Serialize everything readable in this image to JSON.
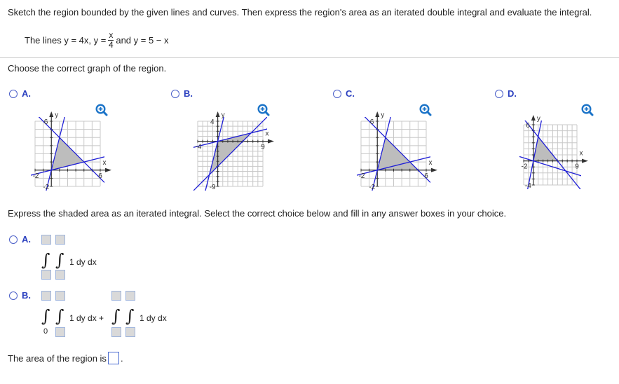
{
  "instructions": "Sketch the region bounded by the given lines and curves. Then express the region's area as an iterated double integral and evaluate the integral.",
  "problem": {
    "prefix": "The lines y = 4x, y =",
    "frac_num": "x",
    "frac_den": "4",
    "suffix": "and y = 5 − x"
  },
  "graph_question": "Choose the correct graph of the region.",
  "graph_options": [
    {
      "label": "A.",
      "zoom_icon": "magnify-plus-icon",
      "xmin": -2,
      "xmax": 6,
      "ymin": -2,
      "ymax": 6,
      "tick_labels": {
        "xmin": "-2",
        "xmax": "6",
        "ymin": "-2",
        "ymax": "6"
      },
      "lines": [
        "y = 4x",
        "y = x/4",
        "y = 5 - x"
      ],
      "shaded_vertices": [
        [
          0,
          0
        ],
        [
          1,
          4
        ],
        [
          4,
          1
        ]
      ]
    },
    {
      "label": "B.",
      "zoom_icon": "magnify-plus-icon",
      "xmin": -4,
      "xmax": 9,
      "ymin": -9,
      "ymax": 4,
      "tick_labels": {
        "xmin": "-4",
        "xmax": "9",
        "ymin": "-9",
        "ymax": "4"
      },
      "lines": [
        "y = 4x",
        "y = x/4",
        "y = x - 5"
      ],
      "shaded_vertices": [
        [
          0,
          0
        ],
        [
          6.67,
          1.67
        ],
        [
          -1.67,
          -6.67
        ]
      ]
    },
    {
      "label": "C.",
      "zoom_icon": "magnify-plus-icon",
      "xmin": -2,
      "xmax": 6,
      "ymin": -2,
      "ymax": 6,
      "tick_labels": {
        "xmin": "-2",
        "xmax": "6",
        "ymin": "-2",
        "ymax": "6"
      },
      "lines": [
        "y = 4x",
        "y = x/4",
        "y = 5 - x"
      ],
      "shaded_vertices": [
        [
          0,
          0
        ],
        [
          1,
          4
        ],
        [
          4,
          1
        ],
        [
          5,
          0
        ]
      ]
    },
    {
      "label": "D.",
      "zoom_icon": "magnify-plus-icon",
      "xmin": -2,
      "xmax": 9,
      "ymin": -4,
      "ymax": 6,
      "tick_labels": {
        "xmin": "-2",
        "xmax": "9",
        "ymin": "-4",
        "ymax": "6"
      },
      "lines": [
        "y = 4x",
        "y = -x/4",
        "y = 5 - x"
      ],
      "shaded_vertices": [
        [
          0,
          0
        ],
        [
          1,
          4
        ],
        [
          5,
          0
        ]
      ]
    }
  ],
  "integral_question": "Express the shaded area as an iterated integral. Select the correct choice below and fill in any answer boxes in your choice.",
  "integral_options": [
    {
      "label": "A.",
      "integrand": "1 dy dx"
    },
    {
      "label": "B.",
      "integrand_1": "1 dy dx +",
      "integrand_2": "1 dy dx",
      "lower_limit_fixed": "0"
    }
  ],
  "area_prompt": "The area of the region is",
  "area_suffix": ".",
  "axis_labels": {
    "x": "x",
    "y": "y"
  },
  "colors": {
    "line": "#1f1fd6",
    "shade": "#bdbdbd",
    "grid": "#c8c8c8",
    "label_blue": "#2a3fbf",
    "zoom_icon": "#1a73c8"
  }
}
